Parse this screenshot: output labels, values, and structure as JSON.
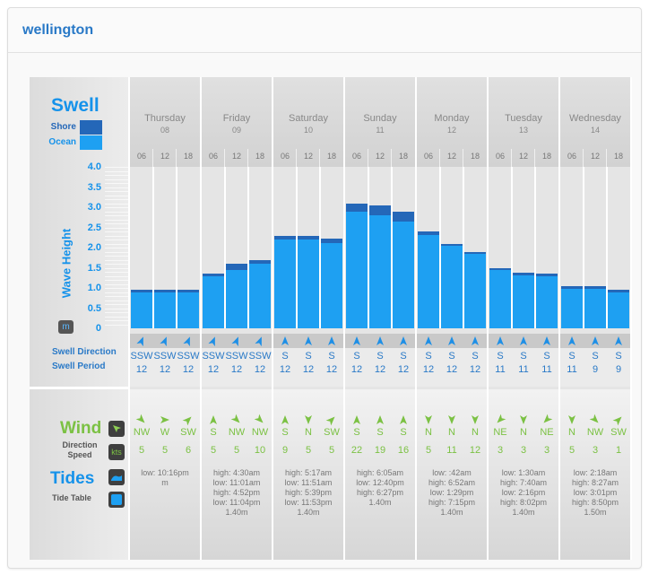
{
  "location": "wellington",
  "swell": {
    "title": "Swell",
    "legend": [
      {
        "label": "Shore",
        "color": "#2467b8",
        "label_color": "#2467b8"
      },
      {
        "label": "Ocean",
        "color": "#1ea0f2",
        "label_color": "#1592ea"
      }
    ],
    "axis_label": "Wave Height",
    "unit_icon": "m",
    "direction_label": "Swell Direction",
    "period_label": "Swell Period"
  },
  "wind": {
    "title": "Wind",
    "direction_label": "Direction",
    "speed_label": "Speed",
    "speed_icon": "kts"
  },
  "tides": {
    "title": "Tides",
    "table_label": "Tide Table"
  },
  "hours": [
    "06",
    "12",
    "18"
  ],
  "days": [
    {
      "name": "Thursday",
      "date": "08",
      "swell_dir": [
        "SSW",
        "SSW",
        "SSW"
      ],
      "swell_period": [
        "12",
        "12",
        "12"
      ],
      "wind_dir": [
        "NW",
        "W",
        "SW"
      ],
      "wind_speed": [
        "5",
        "5",
        "6"
      ],
      "tide": "low: 10:16pm\nm"
    },
    {
      "name": "Friday",
      "date": "09",
      "swell_dir": [
        "SSW",
        "SSW",
        "SSW"
      ],
      "swell_period": [
        "12",
        "12",
        "12"
      ],
      "wind_dir": [
        "S",
        "NW",
        "NW"
      ],
      "wind_speed": [
        "5",
        "5",
        "10"
      ],
      "tide": "high: 4:30am\nlow: 11:01am\nhigh: 4:52pm\nlow: 11:04pm\n1.40m"
    },
    {
      "name": "Saturday",
      "date": "10",
      "swell_dir": [
        "S",
        "S",
        "S"
      ],
      "swell_period": [
        "12",
        "12",
        "12"
      ],
      "wind_dir": [
        "S",
        "N",
        "SW"
      ],
      "wind_speed": [
        "9",
        "5",
        "5"
      ],
      "tide": "high: 5:17am\nlow: 11:51am\nhigh: 5:39pm\nlow: 11:53pm\n1.40m"
    },
    {
      "name": "Sunday",
      "date": "11",
      "swell_dir": [
        "S",
        "S",
        "S"
      ],
      "swell_period": [
        "12",
        "12",
        "12"
      ],
      "wind_dir": [
        "S",
        "S",
        "S"
      ],
      "wind_speed": [
        "22",
        "19",
        "16"
      ],
      "tide": "high: 6:05am\nlow: 12:40pm\nhigh: 6:27pm\n1.40m"
    },
    {
      "name": "Monday",
      "date": "12",
      "swell_dir": [
        "S",
        "S",
        "S"
      ],
      "swell_period": [
        "12",
        "12",
        "12"
      ],
      "wind_dir": [
        "N",
        "N",
        "N"
      ],
      "wind_speed": [
        "5",
        "11",
        "12"
      ],
      "tide": "low: :42am\nhigh: 6:52am\nlow: 1:29pm\nhigh: 7:15pm\n1.40m"
    },
    {
      "name": "Tuesday",
      "date": "13",
      "swell_dir": [
        "S",
        "S",
        "S"
      ],
      "swell_period": [
        "11",
        "11",
        "11"
      ],
      "wind_dir": [
        "NE",
        "N",
        "NE"
      ],
      "wind_speed": [
        "3",
        "3",
        "3"
      ],
      "tide": "low: 1:30am\nhigh: 7:40am\nlow: 2:16pm\nhigh: 8:02pm\n1.40m"
    },
    {
      "name": "Wednesday",
      "date": "14",
      "swell_dir": [
        "S",
        "S",
        "S"
      ],
      "swell_period": [
        "11",
        "9",
        "9"
      ],
      "wind_dir": [
        "N",
        "NW",
        "SW"
      ],
      "wind_speed": [
        "5",
        "3",
        "1"
      ],
      "tide": "low: 2:18am\nhigh: 8:27am\nlow: 3:01pm\nhigh: 8:50pm\n1.50m"
    }
  ],
  "chart_data": {
    "type": "bar",
    "ylabel": "Wave Height",
    "ylim": [
      0,
      4.0
    ],
    "yticks": [
      "4.0",
      "3.5",
      "3.0",
      "2.5",
      "2.0",
      "1.5",
      "1.0",
      "0.5",
      "0"
    ],
    "categories": [
      "Thu 06",
      "Thu 12",
      "Thu 18",
      "Fri 06",
      "Fri 12",
      "Fri 18",
      "Sat 06",
      "Sat 12",
      "Sat 18",
      "Sun 06",
      "Sun 12",
      "Sun 18",
      "Mon 06",
      "Mon 12",
      "Mon 18",
      "Tue 06",
      "Tue 12",
      "Tue 18",
      "Wed 06",
      "Wed 12",
      "Wed 18"
    ],
    "series": [
      {
        "name": "Shore",
        "color": "#2467b8",
        "values": [
          0.95,
          0.95,
          0.95,
          1.35,
          1.6,
          1.68,
          2.28,
          2.3,
          2.22,
          3.1,
          3.05,
          2.88,
          2.4,
          2.1,
          1.9,
          1.5,
          1.38,
          1.35,
          1.04,
          1.04,
          0.95
        ]
      },
      {
        "name": "Ocean",
        "color": "#1ea0f2",
        "values": [
          0.88,
          0.88,
          0.88,
          1.28,
          1.45,
          1.6,
          2.2,
          2.2,
          2.12,
          2.88,
          2.8,
          2.65,
          2.32,
          2.05,
          1.84,
          1.44,
          1.32,
          1.28,
          0.98,
          0.98,
          0.9
        ]
      }
    ]
  },
  "colors": {
    "location_title": "#2979c7",
    "swell_blue": "#1592ea",
    "wind_green": "#7bc143",
    "arrow_blue": "#1e8fe6"
  }
}
